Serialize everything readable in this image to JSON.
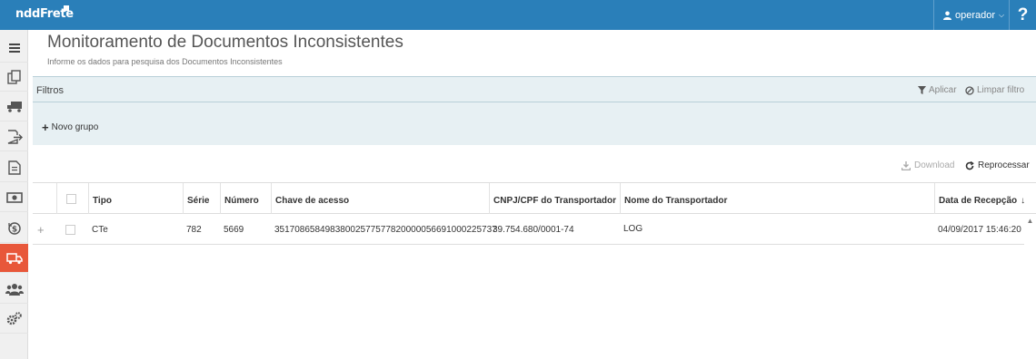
{
  "header": {
    "logo": "nddFrete",
    "user": "operador",
    "help": "?"
  },
  "sidebar": {
    "items": [
      {
        "icon": "menu-icon"
      },
      {
        "icon": "documents-icon"
      },
      {
        "icon": "truck-icon"
      },
      {
        "icon": "export-icon"
      },
      {
        "icon": "file-icon"
      },
      {
        "icon": "money-icon"
      },
      {
        "icon": "dollar-cycle-icon"
      },
      {
        "icon": "truck-alert-icon",
        "active": true
      },
      {
        "icon": "users-icon"
      },
      {
        "icon": "settings-icon"
      }
    ]
  },
  "page": {
    "title": "Monitoramento de Documentos Inconsistentes",
    "subtitle": "Informe os dados para pesquisa dos Documentos Inconsistentes"
  },
  "filters": {
    "label": "Filtros",
    "apply": "Aplicar",
    "clear": "Limpar filtro",
    "new_group": "Novo grupo"
  },
  "toolbar": {
    "download": "Download",
    "reprocess": "Reprocessar"
  },
  "grid": {
    "columns": [
      "Tipo",
      "Série",
      "Número",
      "Chave de acesso",
      "CNPJ/CPF do Transportador",
      "Nome do Transportador",
      "Data de Recepção"
    ],
    "sort_indicator": "↓",
    "rows": [
      {
        "tipo": "CTe",
        "serie": "782",
        "numero": "5669",
        "chave": "35170865849838002577577820000056691000225737",
        "cnpj": "39.754.680/0001-74",
        "nome": "LOG",
        "data": "04/09/2017 15:46:20"
      }
    ]
  },
  "colors": {
    "topbar": "#2a7fb9",
    "active_sidebar": "#e8573a",
    "filter_bg": "#e7f0f3"
  }
}
